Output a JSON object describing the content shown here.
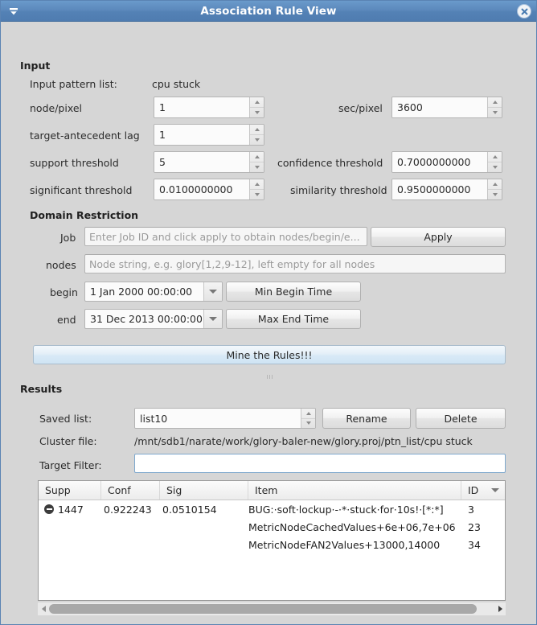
{
  "window": {
    "title": "Association Rule View",
    "menu_icon": "window-menu-icon",
    "close_icon": "close-icon"
  },
  "input_section": {
    "title": "Input",
    "pattern_list_label": "Input pattern list:",
    "pattern_list_value": "cpu stuck",
    "fields": [
      {
        "label": "node/pixel",
        "value": "1"
      },
      {
        "label": "sec/pixel",
        "value": "3600"
      },
      {
        "label": "target-antecedent lag",
        "value": "1"
      },
      {
        "label": "support threshold",
        "value": "5"
      },
      {
        "label": "confidence threshold",
        "value": "0.7000000000"
      },
      {
        "label": "significant threshold",
        "value": "0.0100000000"
      },
      {
        "label": "similarity threshold",
        "value": "0.9500000000"
      }
    ]
  },
  "domain_section": {
    "title": "Domain Restriction",
    "job_label": "Job",
    "job_placeholder": "Enter Job ID and click apply to obtain nodes/begin/e...",
    "job_value": "",
    "apply_label": "Apply",
    "nodes_label": "nodes",
    "nodes_placeholder": "Node string, e.g. glory[1,2,9-12], left empty for all nodes",
    "nodes_value": "",
    "begin_label": "begin",
    "begin_value": "1 Jan 2000 00:00:00",
    "min_begin_label": "Min Begin Time",
    "end_label": "end",
    "end_value": "31 Dec 2013 00:00:00",
    "max_end_label": "Max End Time"
  },
  "mine_button_label": "Mine the Rules!!!",
  "results_section": {
    "title": "Results",
    "saved_list_label": "Saved list:",
    "saved_list_value": "list10",
    "rename_label": "Rename",
    "delete_label": "Delete",
    "cluster_file_label": "Cluster file:",
    "cluster_file_value": "/mnt/sdb1/narate/work/glory-baler-new/glory.proj/ptn_list/cpu stuck",
    "target_filter_label": "Target Filter:",
    "target_filter_value": "",
    "table": {
      "columns": [
        "Supp",
        "Conf",
        "Sig",
        "Item",
        "ID"
      ],
      "sorted_column": "ID",
      "rows": [
        {
          "supp": "1447",
          "conf": "0.922243",
          "sig": "0.0510154",
          "item": "BUG:·soft·lockup·-·*·stuck·for·10s!·[*:*]",
          "id": "3",
          "expandable": true
        },
        {
          "supp": "",
          "conf": "",
          "sig": "",
          "item": "MetricNodeCachedValues+6e+06,7e+06",
          "id": "23",
          "expandable": false
        },
        {
          "supp": "",
          "conf": "",
          "sig": "",
          "item": "MetricNodeFAN2Values+13000,14000",
          "id": "34",
          "expandable": false
        }
      ]
    }
  },
  "colors": {
    "titlebar": "#5b88bb",
    "window_bg": "#d6d6d6",
    "accent_button": "#d8e9f6"
  }
}
